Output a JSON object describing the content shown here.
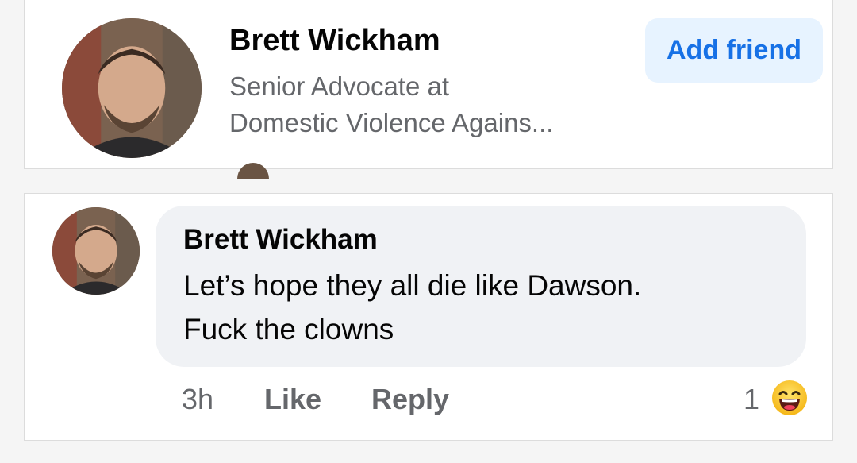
{
  "profile": {
    "name": "Brett Wickham",
    "subtitle_line1": "Senior Advocate at",
    "subtitle_line2": "Domestic Violence Agains...",
    "add_friend_label": "Add friend"
  },
  "comment": {
    "author": "Brett Wickham",
    "text_line1": "Let’s hope they all die like Dawson.",
    "text_line2": "Fuck the clowns",
    "timestamp": "3h",
    "like_label": "Like",
    "reply_label": "Reply",
    "reaction_count": "1",
    "reaction_icon": "laughing-emoji-icon"
  },
  "colors": {
    "name_text": "#050505",
    "secondary_text": "#65676b",
    "accent_blue": "#1771e6",
    "button_bg": "#e7f3ff",
    "bubble_bg": "#f0f2f5"
  }
}
